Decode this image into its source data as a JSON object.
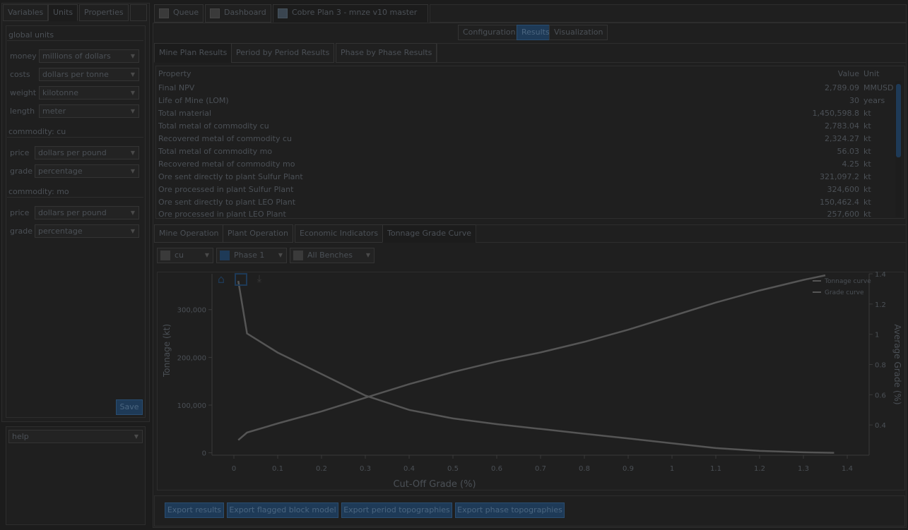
{
  "left_tabs": [
    "Variables",
    "Units",
    "Properties"
  ],
  "units": {
    "global_section": "global units",
    "global_rows": [
      {
        "label": "money",
        "value": "millions of dollars"
      },
      {
        "label": "costs",
        "value": "dollars per tonne"
      },
      {
        "label": "weight",
        "value": "kilotonne"
      },
      {
        "label": "length",
        "value": "meter"
      }
    ],
    "commodity_cu_section": "commodity: cu",
    "commodity_cu_rows": [
      {
        "label": "price",
        "value": "dollars per pound"
      },
      {
        "label": "grade",
        "value": "percentage"
      }
    ],
    "commodity_mo_section": "commodity: mo",
    "commodity_mo_rows": [
      {
        "label": "price",
        "value": "dollars per pound"
      },
      {
        "label": "grade",
        "value": "percentage"
      }
    ],
    "save_label": "Save"
  },
  "help": {
    "label": "help"
  },
  "top_tabs": [
    "Queue",
    "Dashboard",
    "Cobre Plan 3 - mnze v10 master"
  ],
  "view_tabs": [
    "Configuration",
    "Results",
    "Visualization"
  ],
  "results_tabs": [
    "Mine Plan Results",
    "Period by Period Results",
    "Phase by Phase Results"
  ],
  "table": {
    "headers": {
      "property": "Property",
      "value": "Value",
      "unit": "Unit"
    },
    "rows": [
      {
        "property": "Final NPV",
        "value": "2,789.09",
        "unit": "MMUSD"
      },
      {
        "property": "Life of Mine (LOM)",
        "value": "30",
        "unit": "years"
      },
      {
        "property": "Total material",
        "value": "1,450,598.8",
        "unit": "kt"
      },
      {
        "property": "Total metal of commodity cu",
        "value": "2,783.04",
        "unit": "kt"
      },
      {
        "property": "Recovered metal of commodity cu",
        "value": "2,324.27",
        "unit": "kt"
      },
      {
        "property": "Total metal of commodity mo",
        "value": "56.03",
        "unit": "kt"
      },
      {
        "property": "Recovered metal of commodity mo",
        "value": "4.25",
        "unit": "kt"
      },
      {
        "property": "Ore sent directly to plant Sulfur Plant",
        "value": "321,097.2",
        "unit": "kt"
      },
      {
        "property": "Ore processed in plant Sulfur Plant",
        "value": "324,600",
        "unit": "kt"
      },
      {
        "property": "Ore sent directly to plant LEO Plant",
        "value": "150,462.4",
        "unit": "kt"
      },
      {
        "property": "Ore processed in plant LEO Plant",
        "value": "257,600",
        "unit": "kt"
      }
    ]
  },
  "chart_tabs": [
    "Mine Operation",
    "Plant Operation",
    "Economic Indicators",
    "Tonnage Grade Curve"
  ],
  "filters": {
    "commodity": "cu",
    "phase": "Phase 1",
    "benches": "All Benches"
  },
  "bottom_buttons": [
    "Export results",
    "Export flagged block model",
    "Export period topographies",
    "Export phase topographies"
  ],
  "colors": {
    "accent": "#1e3a57",
    "line": "#555555"
  },
  "chart_data": {
    "type": "line",
    "xlabel": "Cut-Off Grade (%)",
    "ylabel": "Tonnage (kt)",
    "y2label": "Average Grade (%)",
    "x_ticks": [
      "0",
      "0.1",
      "0.2",
      "0.3",
      "0.4",
      "0.5",
      "0.6",
      "0.7",
      "0.8",
      "0.9",
      "1",
      "1.1",
      "1.2",
      "1.3",
      "1.4"
    ],
    "y_ticks": [
      "0",
      "100,000",
      "200,000",
      "300,000"
    ],
    "y2_ticks": [
      "0.4",
      "0.6",
      "0.8",
      "1",
      "1.2",
      "1.4"
    ],
    "xlim": [
      -0.05,
      1.45
    ],
    "ylim": [
      -5000,
      375000
    ],
    "y2lim": [
      0.2,
      1.4
    ],
    "legend_position": "top-right",
    "series": [
      {
        "name": "Tonnage curve",
        "axis": "left",
        "x": [
          0.01,
          0.03,
          0.1,
          0.2,
          0.3,
          0.4,
          0.5,
          0.6,
          0.7,
          0.8,
          0.9,
          1.0,
          1.1,
          1.2,
          1.3,
          1.37
        ],
        "y": [
          360000,
          250000,
          210000,
          165000,
          120000,
          90000,
          72000,
          60000,
          50000,
          40000,
          30000,
          20000,
          10000,
          4000,
          1000,
          0
        ]
      },
      {
        "name": "Grade curve",
        "axis": "right",
        "x": [
          0.01,
          0.03,
          0.1,
          0.2,
          0.3,
          0.4,
          0.5,
          0.6,
          0.7,
          0.8,
          0.9,
          1.0,
          1.1,
          1.2,
          1.3,
          1.35
        ],
        "y": [
          0.3,
          0.35,
          0.41,
          0.49,
          0.58,
          0.67,
          0.75,
          0.82,
          0.88,
          0.95,
          1.03,
          1.12,
          1.21,
          1.29,
          1.36,
          1.39
        ]
      }
    ]
  }
}
